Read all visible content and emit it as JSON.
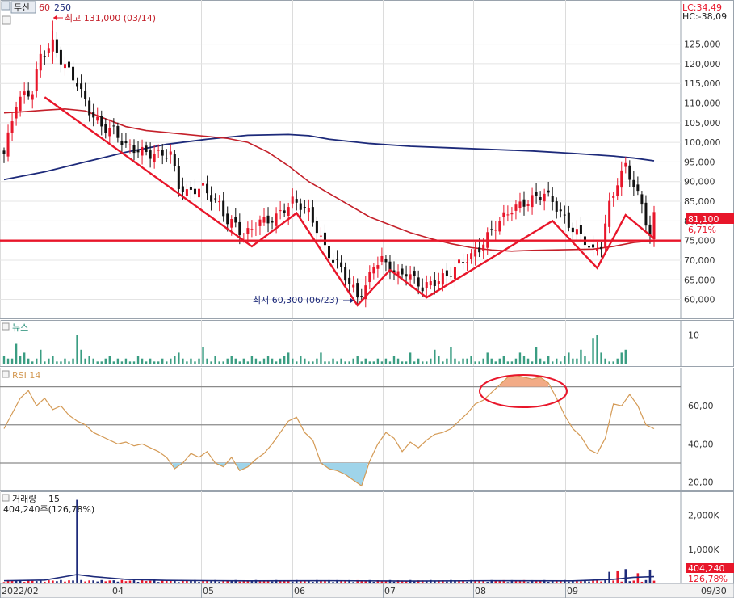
{
  "header": {
    "ticker": "두산",
    "ma_short": "60",
    "ma_long": "250",
    "lc_label": "LC:34,49",
    "hc_label": "HC:-38,09"
  },
  "panels": {
    "news_label": "뉴스",
    "rsi_label": "RSI 14",
    "volume_label": "거래량",
    "volume_ma": "15",
    "volume_info": "404,240주(126,78%)"
  },
  "annotations": {
    "high_label": "최고 131,000 (03/14)",
    "low_label": "최저 60,300 (06/23)"
  },
  "last_price": {
    "price": "81,100",
    "change": "6,71%"
  },
  "last_volume": {
    "volume": "404,240",
    "ratio": "126,78%"
  },
  "colors": {
    "up": "#e8162a",
    "down": "#111111",
    "ma_short": "#c4202a",
    "ma_long": "#1d2a7a",
    "news_bar": "#3a9d82",
    "rsi_line": "#d49a55",
    "rsi_overbought": "#f2ab86",
    "rsi_oversold": "#9fd4ea",
    "trend_line": "#e8162a"
  },
  "chart_data": [
    {
      "type": "candlestick",
      "x_ticks": [
        "2022/02",
        "04",
        "05",
        "06",
        "07",
        "08",
        "09",
        "09/30"
      ],
      "y_ticks": [
        "125,000",
        "120,000",
        "115,000",
        "110,000",
        "105,000",
        "100,000",
        "95,000",
        "90,000",
        "85,000",
        "80,000",
        "75,000",
        "70,000",
        "65,000",
        "60,000"
      ],
      "ylim": [
        56000,
        135000
      ],
      "high": {
        "value": 131000,
        "date": "03/14"
      },
      "low": {
        "value": 60300,
        "date": "06/23"
      },
      "support_line": 75000,
      "close_path": [
        [
          0,
          97000
        ],
        [
          3,
          110000
        ],
        [
          5,
          112000
        ],
        [
          7,
          113000
        ],
        [
          9,
          122000
        ],
        [
          12,
          125000
        ],
        [
          14,
          121000
        ],
        [
          16,
          118000
        ],
        [
          18,
          115000
        ],
        [
          21,
          108000
        ],
        [
          24,
          104000
        ],
        [
          27,
          103000
        ],
        [
          30,
          99000
        ],
        [
          33,
          98000
        ],
        [
          36,
          97000
        ],
        [
          39,
          97000
        ],
        [
          41,
          97000
        ],
        [
          43,
          89000
        ],
        [
          45,
          87000
        ],
        [
          47,
          88000
        ],
        [
          49,
          88500
        ],
        [
          51,
          86000
        ],
        [
          53,
          84000
        ],
        [
          55,
          80000
        ],
        [
          57,
          79000
        ],
        [
          59,
          76000
        ],
        [
          61,
          78000
        ],
        [
          63,
          80000
        ],
        [
          65,
          80000
        ],
        [
          67,
          81000
        ],
        [
          69,
          83000
        ],
        [
          71,
          85000
        ],
        [
          73,
          84000
        ],
        [
          75,
          82000
        ],
        [
          77,
          78000
        ],
        [
          79,
          73000
        ],
        [
          81,
          70000
        ],
        [
          83,
          68000
        ],
        [
          85,
          64000
        ],
        [
          87,
          61000
        ],
        [
          89,
          63000
        ],
        [
          91,
          69000
        ],
        [
          93,
          70000
        ],
        [
          95,
          68000
        ],
        [
          97,
          66000
        ],
        [
          99,
          67000
        ],
        [
          101,
          65000
        ],
        [
          103,
          63000
        ],
        [
          105,
          64000
        ],
        [
          107,
          65000
        ],
        [
          109,
          66000
        ],
        [
          111,
          68000
        ],
        [
          113,
          70000
        ],
        [
          115,
          71000
        ],
        [
          117,
          73000
        ],
        [
          119,
          76000
        ],
        [
          121,
          79000
        ],
        [
          123,
          81000
        ],
        [
          125,
          83000
        ],
        [
          127,
          84000
        ],
        [
          129,
          85000
        ],
        [
          131,
          86000
        ],
        [
          133,
          87000
        ],
        [
          135,
          85000
        ],
        [
          137,
          82000
        ],
        [
          139,
          79000
        ],
        [
          141,
          77000
        ],
        [
          143,
          75000
        ],
        [
          145,
          72000
        ],
        [
          147,
          74000
        ],
        [
          149,
          84000
        ],
        [
          151,
          90000
        ],
        [
          153,
          94000
        ],
        [
          155,
          89000
        ],
        [
          157,
          84000
        ],
        [
          159,
          76000
        ],
        [
          160,
          81100
        ]
      ],
      "ma60": [
        [
          0,
          107500
        ],
        [
          5,
          107800
        ],
        [
          10,
          108200
        ],
        [
          15,
          108500
        ],
        [
          20,
          108000
        ],
        [
          25,
          106000
        ],
        [
          30,
          104000
        ],
        [
          35,
          103000
        ],
        [
          40,
          102500
        ],
        [
          45,
          102000
        ],
        [
          50,
          101500
        ],
        [
          55,
          101000
        ],
        [
          60,
          100000
        ],
        [
          65,
          97500
        ],
        [
          70,
          94000
        ],
        [
          75,
          90000
        ],
        [
          80,
          87000
        ],
        [
          85,
          84000
        ],
        [
          90,
          81000
        ],
        [
          95,
          79000
        ],
        [
          100,
          77000
        ],
        [
          105,
          75500
        ],
        [
          110,
          74200
        ],
        [
          115,
          73200
        ],
        [
          120,
          72600
        ],
        [
          125,
          72300
        ],
        [
          130,
          72500
        ],
        [
          135,
          72600
        ],
        [
          140,
          72700
        ],
        [
          145,
          72800
        ],
        [
          150,
          73500
        ],
        [
          155,
          74500
        ],
        [
          160,
          75000
        ]
      ],
      "ma250": [
        [
          0,
          90500
        ],
        [
          10,
          92500
        ],
        [
          20,
          95000
        ],
        [
          30,
          97500
        ],
        [
          40,
          99500
        ],
        [
          50,
          100800
        ],
        [
          60,
          101800
        ],
        [
          70,
          102000
        ],
        [
          75,
          101700
        ],
        [
          80,
          100800
        ],
        [
          90,
          99700
        ],
        [
          100,
          99000
        ],
        [
          110,
          98600
        ],
        [
          120,
          98200
        ],
        [
          130,
          97800
        ],
        [
          140,
          97200
        ],
        [
          150,
          96500
        ],
        [
          155,
          96000
        ],
        [
          160,
          95300
        ]
      ],
      "trend_pattern": [
        [
          10,
          111500
        ],
        [
          61,
          73500
        ],
        [
          72,
          82000
        ],
        [
          87,
          58500
        ],
        [
          95,
          67500
        ],
        [
          104,
          60500
        ],
        [
          135,
          80000
        ],
        [
          146,
          68000
        ],
        [
          153,
          81500
        ],
        [
          160,
          75500
        ]
      ]
    },
    {
      "type": "bar",
      "name": "news",
      "y_ticks": [
        "10"
      ],
      "ylim": [
        0,
        14
      ],
      "values": [
        3,
        2,
        2,
        7,
        3,
        4,
        2,
        1,
        2,
        5,
        1,
        2,
        3,
        1,
        1,
        2,
        1,
        2,
        10,
        5,
        2,
        3,
        2,
        1,
        1,
        2,
        3,
        1,
        2,
        1,
        2,
        1,
        1,
        3,
        2,
        1,
        2,
        1,
        1,
        2,
        1,
        2,
        3,
        4,
        2,
        1,
        2,
        1,
        2,
        6,
        2,
        1,
        3,
        1,
        1,
        2,
        3,
        2,
        1,
        2,
        1,
        3,
        2,
        1,
        2,
        3,
        2,
        1,
        2,
        3,
        4,
        2,
        1,
        3,
        2,
        1,
        1,
        2,
        4,
        1,
        1,
        2,
        1,
        2,
        1,
        1,
        2,
        3,
        1,
        2,
        1,
        1,
        2,
        1,
        2,
        1,
        3,
        2,
        1,
        1,
        4,
        1,
        2,
        1,
        1,
        2,
        5,
        3,
        1,
        2,
        6,
        2,
        1,
        2,
        2,
        3,
        1,
        1,
        2,
        4,
        2,
        1,
        2,
        3,
        1,
        1,
        2,
        4,
        3,
        2,
        1,
        6,
        2,
        1,
        3,
        1,
        2,
        1,
        3,
        4,
        2,
        2,
        5,
        3,
        1,
        9,
        10,
        4,
        2,
        1,
        1,
        2,
        4,
        5
      ],
      "x_start": 0
    },
    {
      "type": "line",
      "name": "RSI 14",
      "y_ticks": [
        "60,00",
        "40,00",
        "20,00"
      ],
      "ylim": [
        16,
        80
      ],
      "levels": [
        70,
        50,
        30
      ],
      "values": [
        [
          0,
          48
        ],
        [
          2,
          56
        ],
        [
          4,
          64
        ],
        [
          6,
          68
        ],
        [
          8,
          60
        ],
        [
          10,
          64
        ],
        [
          12,
          58
        ],
        [
          14,
          60
        ],
        [
          16,
          55
        ],
        [
          18,
          52
        ],
        [
          20,
          50
        ],
        [
          22,
          46
        ],
        [
          24,
          44
        ],
        [
          26,
          42
        ],
        [
          28,
          40
        ],
        [
          30,
          41
        ],
        [
          32,
          39
        ],
        [
          34,
          40
        ],
        [
          36,
          38
        ],
        [
          38,
          36
        ],
        [
          40,
          33
        ],
        [
          42,
          27
        ],
        [
          44,
          30
        ],
        [
          46,
          35
        ],
        [
          48,
          33
        ],
        [
          50,
          36
        ],
        [
          52,
          30
        ],
        [
          54,
          28
        ],
        [
          56,
          33
        ],
        [
          58,
          26
        ],
        [
          60,
          28
        ],
        [
          62,
          32
        ],
        [
          64,
          35
        ],
        [
          66,
          40
        ],
        [
          68,
          46
        ],
        [
          70,
          52
        ],
        [
          72,
          54
        ],
        [
          74,
          46
        ],
        [
          76,
          42
        ],
        [
          78,
          30
        ],
        [
          80,
          27
        ],
        [
          82,
          26
        ],
        [
          84,
          24
        ],
        [
          86,
          21
        ],
        [
          88,
          18
        ],
        [
          90,
          31
        ],
        [
          92,
          40
        ],
        [
          94,
          46
        ],
        [
          96,
          43
        ],
        [
          98,
          36
        ],
        [
          100,
          41
        ],
        [
          102,
          38
        ],
        [
          104,
          42
        ],
        [
          106,
          45
        ],
        [
          108,
          46
        ],
        [
          110,
          48
        ],
        [
          112,
          52
        ],
        [
          114,
          56
        ],
        [
          116,
          61
        ],
        [
          118,
          63
        ],
        [
          120,
          67
        ],
        [
          122,
          71
        ],
        [
          124,
          75
        ],
        [
          126,
          76
        ],
        [
          128,
          75
        ],
        [
          130,
          74
        ],
        [
          132,
          75
        ],
        [
          134,
          72
        ],
        [
          136,
          64
        ],
        [
          138,
          55
        ],
        [
          140,
          48
        ],
        [
          142,
          44
        ],
        [
          144,
          37
        ],
        [
          146,
          35
        ],
        [
          148,
          43
        ],
        [
          150,
          61
        ],
        [
          152,
          60
        ],
        [
          154,
          66
        ],
        [
          156,
          60
        ],
        [
          158,
          50
        ],
        [
          160,
          48
        ]
      ]
    },
    {
      "type": "bar",
      "name": "volume",
      "y_ticks": [
        "2,000K",
        "1,000K"
      ],
      "ylim": [
        0,
        2700
      ],
      "spike": {
        "x": 18,
        "value": 2450
      },
      "recent_spikes": [
        [
          149,
          340
        ],
        [
          151,
          380
        ],
        [
          153,
          420
        ],
        [
          156,
          300
        ],
        [
          159,
          404
        ]
      ],
      "ma15_points": [
        [
          0,
          80
        ],
        [
          10,
          100
        ],
        [
          18,
          260
        ],
        [
          22,
          200
        ],
        [
          30,
          120
        ],
        [
          40,
          90
        ],
        [
          60,
          75
        ],
        [
          80,
          80
        ],
        [
          100,
          70
        ],
        [
          120,
          80
        ],
        [
          140,
          75
        ],
        [
          150,
          120
        ],
        [
          155,
          180
        ],
        [
          160,
          200
        ]
      ]
    }
  ]
}
